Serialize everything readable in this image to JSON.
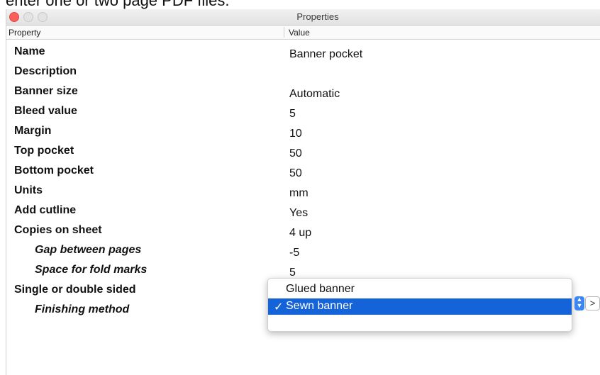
{
  "background_text": "enter one or two page PDF files.",
  "window": {
    "title": "Properties"
  },
  "table": {
    "headers": {
      "property": "Property",
      "value": "Value"
    },
    "rows": [
      {
        "property": "Name",
        "value": "Banner pocket",
        "sub": false
      },
      {
        "property": "Description",
        "value": "",
        "sub": false
      },
      {
        "property": "Banner size",
        "value": "Automatic",
        "sub": false
      },
      {
        "property": "Bleed value",
        "value": "5",
        "sub": false
      },
      {
        "property": "Margin",
        "value": "10",
        "sub": false
      },
      {
        "property": "Top pocket",
        "value": "50",
        "sub": false
      },
      {
        "property": "Bottom pocket",
        "value": "50",
        "sub": false
      },
      {
        "property": "Units",
        "value": "mm",
        "sub": false
      },
      {
        "property": "Add cutline",
        "value": "Yes",
        "sub": false
      },
      {
        "property": "Copies on sheet",
        "value": "4 up",
        "sub": false
      },
      {
        "property": "Gap between pages",
        "value": "-5",
        "sub": true
      },
      {
        "property": "Space for fold marks",
        "value": "5",
        "sub": true
      },
      {
        "property": "Single or double sided",
        "value": "",
        "sub": false
      },
      {
        "property": "Finishing method",
        "value": "",
        "sub": true
      }
    ]
  },
  "dropdown": {
    "options": [
      {
        "label": "Glued banner",
        "selected": false
      },
      {
        "label": "Sewn banner",
        "selected": true
      }
    ],
    "check_glyph": "✓"
  },
  "controls": {
    "more_button_label": ">",
    "stepper_up": "▲",
    "stepper_down": "▼"
  },
  "colors": {
    "selection": "#1463d8",
    "close_button": "#fc605c",
    "stepper": "#3c86f3"
  }
}
